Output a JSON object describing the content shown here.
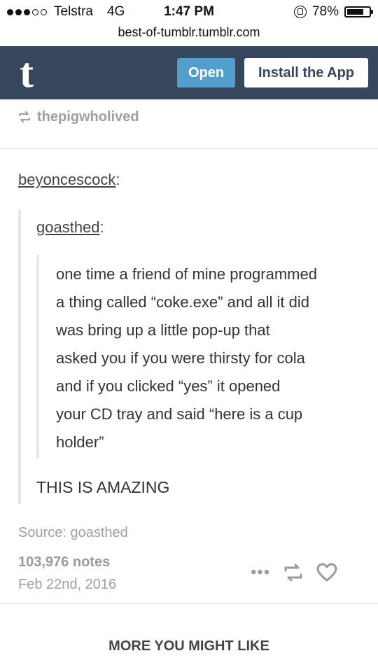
{
  "status_bar": {
    "carrier": "Telstra",
    "network": "4G",
    "time": "1:47 PM",
    "battery": "78%",
    "battery_level": 0.78
  },
  "browser": {
    "url": "best-of-tumblr.tumblr.com"
  },
  "header": {
    "logo": "t",
    "open_label": "Open",
    "install_label": "Install the App",
    "bg_color": "#36465d",
    "open_color": "#529ecc"
  },
  "post": {
    "reblogged_from": "thepigwholived",
    "user_a": "beyoncescock",
    "user_b": "goasthed",
    "quote_lines": [
      "one time a friend of mine programmed",
      "a thing called “coke.exe” and all it did",
      "was bring up a little pop-up that",
      "asked you if you were thirsty for cola",
      "and if you clicked “yes” it opened",
      "your CD tray and said “here is a cup",
      "holder”"
    ],
    "reply": "THIS IS AMAZING",
    "source": "Source: goasthed",
    "notes": "103,976 notes",
    "date": "Feb 22nd, 2016"
  },
  "footer": {
    "more_label": "MORE YOU MIGHT LIKE"
  },
  "icons": {
    "reblog": "reblog-icon",
    "heart": "heart-icon",
    "more": "more-icon",
    "lock": "orientation-lock-icon",
    "battery": "battery-icon"
  }
}
